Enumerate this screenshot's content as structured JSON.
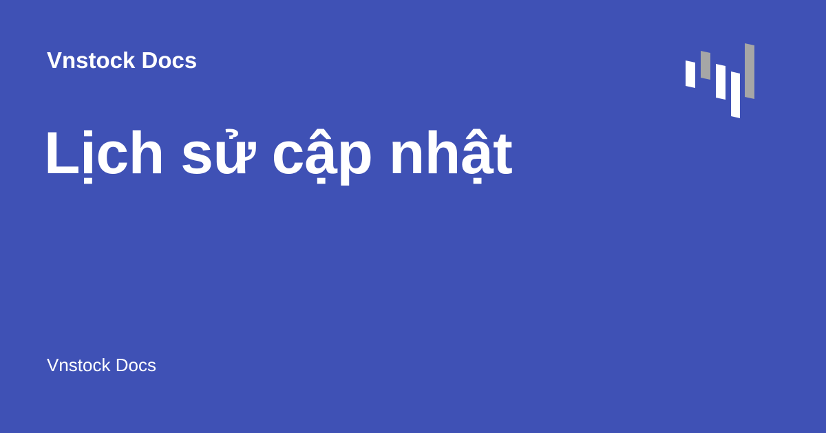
{
  "header": {
    "site_name": "Vnstock Docs"
  },
  "main": {
    "title": "Lịch sử cập nhật"
  },
  "footer": {
    "site_name": "Vnstock Docs"
  },
  "logo": {
    "icon": "vnstock-logo-icon"
  },
  "colors": {
    "background": "#3f51b5",
    "text": "#ffffff",
    "logo_white": "#ffffff",
    "logo_gray": "#a6a6a6"
  }
}
